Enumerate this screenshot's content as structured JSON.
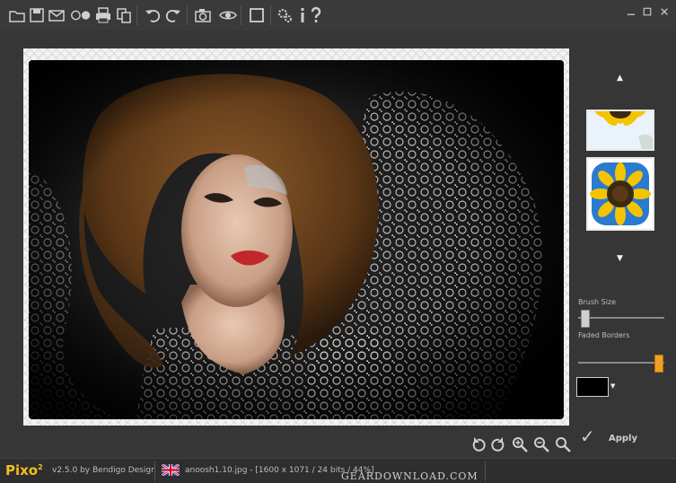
{
  "toolbar": {
    "icons": [
      "open-folder-icon",
      "save-icon",
      "email-icon",
      "circles-icon",
      "print-icon",
      "copy-icon",
      "undo-icon",
      "redo-icon",
      "camera-icon",
      "eye-icon",
      "crop-frame-icon",
      "settings-gears-icon",
      "info-icon",
      "help-icon"
    ]
  },
  "window": {
    "minimize": "—",
    "maximize": "☐",
    "close": "✕"
  },
  "right_panel": {
    "scroll_up": "▲",
    "scroll_down": "▼",
    "brush_size_label": "Brush Size",
    "brush_size_value": 0.03,
    "faded_borders_label": "Faded Borders",
    "faded_borders_value": 0.97,
    "color_swatch": "#000000",
    "apply_label": "Apply",
    "apply_icon": "checkmark-icon"
  },
  "bottom_tools": [
    "rotate-left-icon",
    "rotate-right-icon",
    "zoom-in-icon",
    "zoom-out-icon",
    "zoom-fit-icon"
  ],
  "status": {
    "logo": "Pixo",
    "logo_sup": "2",
    "version": "v2.5.0 by Bendigo Design",
    "file_info": "anoosh1.10.jpg - [1600 x 1071 / 24 bits / 44%]",
    "watermark": "GEARDOWNLOAD.COM"
  },
  "colors": {
    "accent": "#f0a020",
    "background": "#363636",
    "logo": "#f0c020"
  }
}
